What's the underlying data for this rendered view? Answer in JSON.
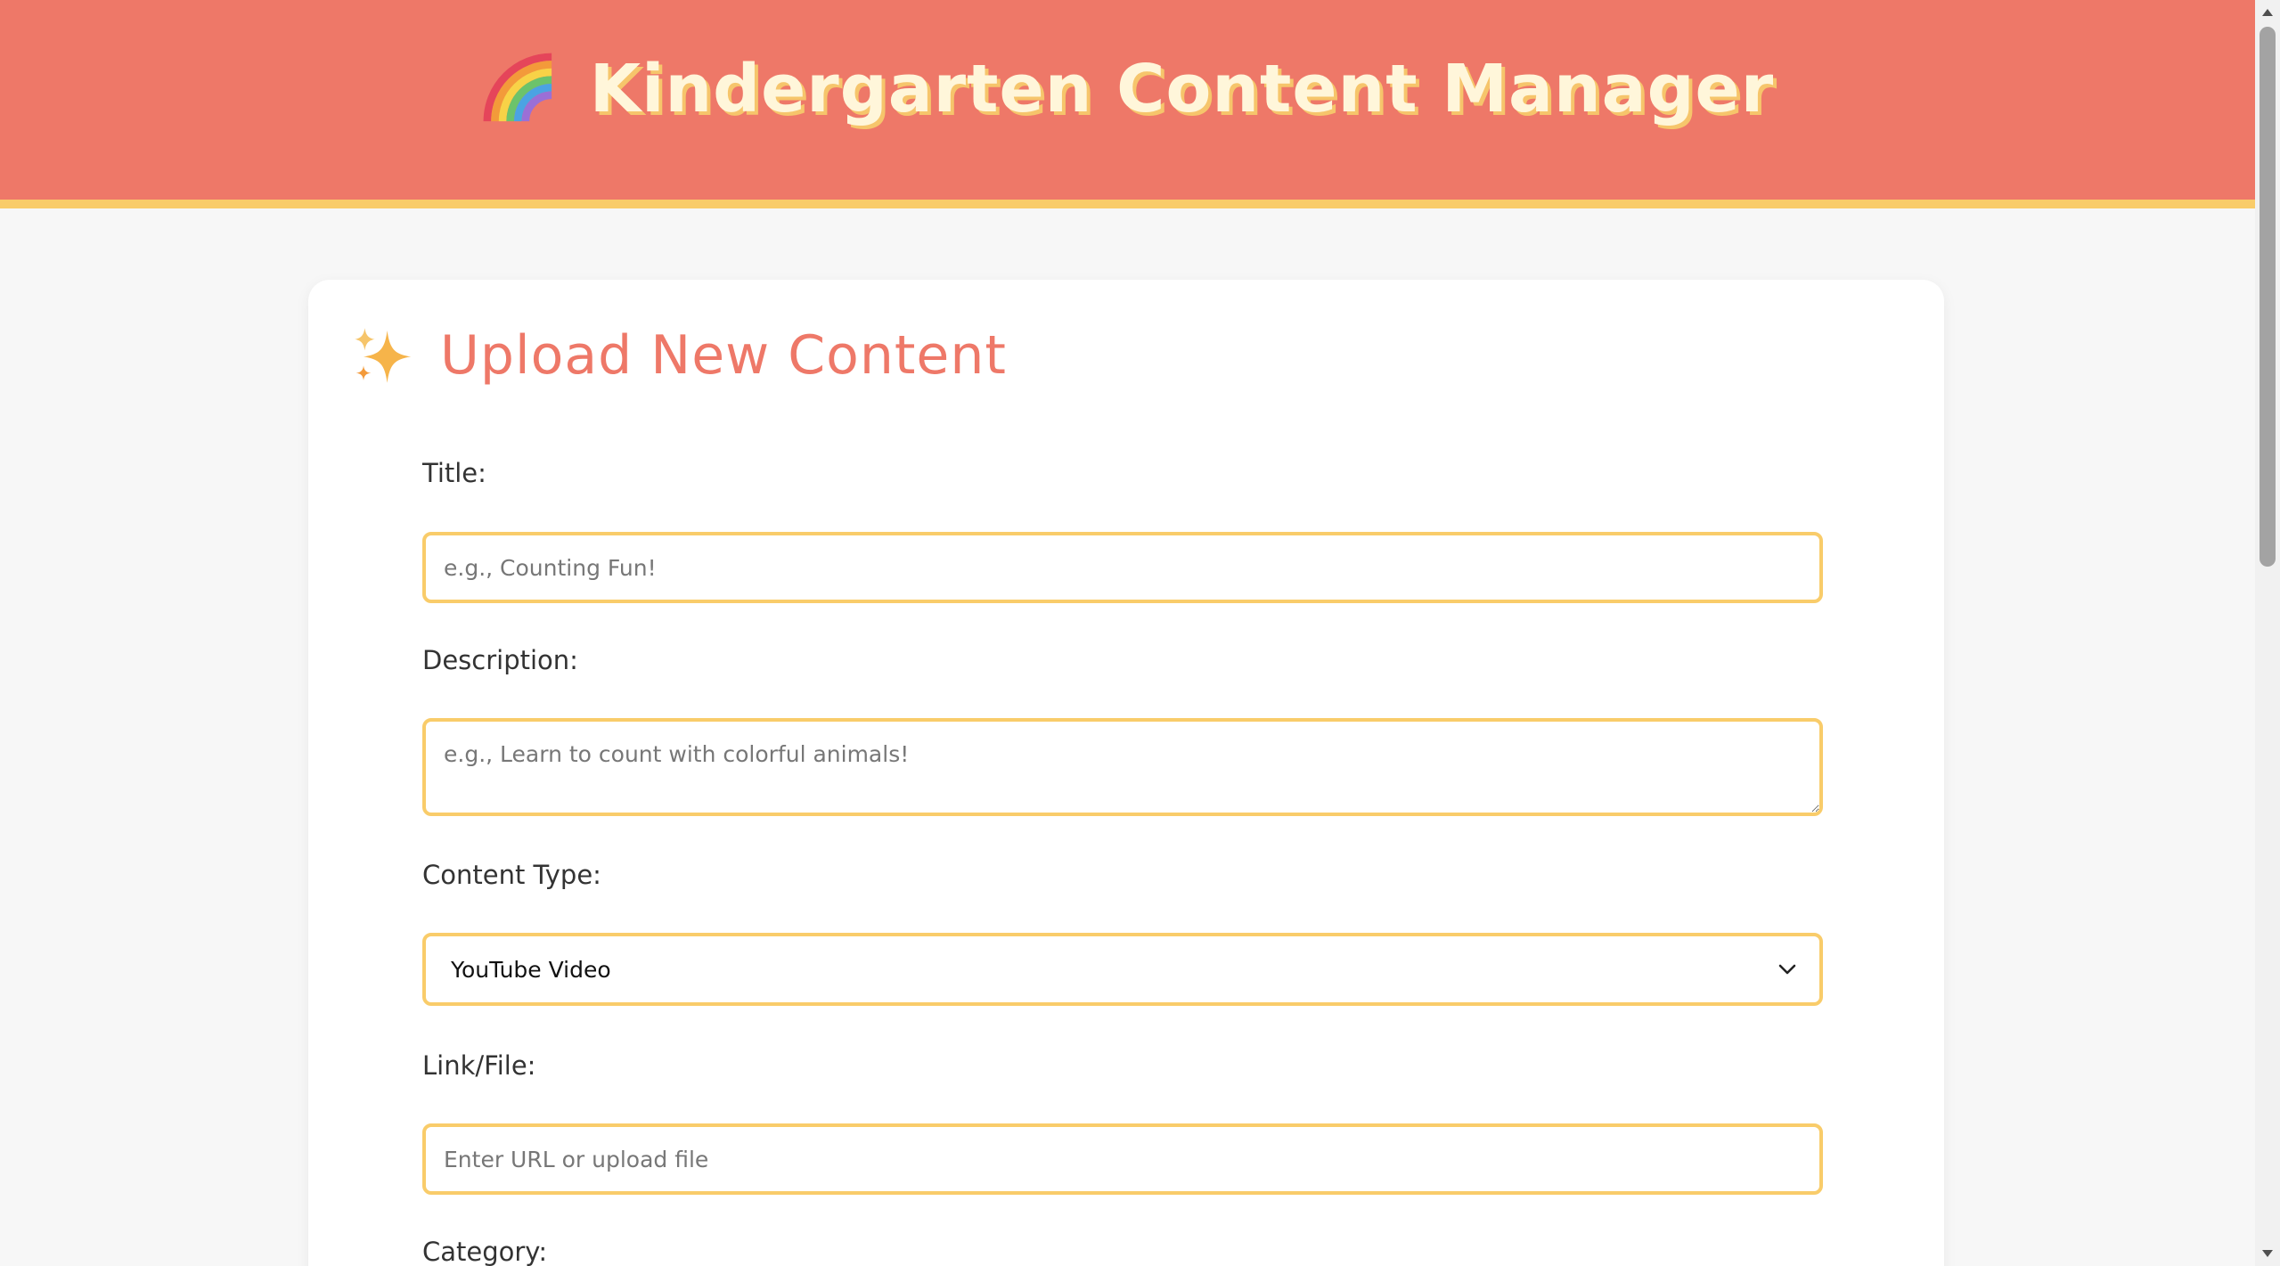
{
  "header": {
    "icon": "rainbow-icon",
    "title": "Kindergarten Content Manager"
  },
  "upload": {
    "icon": "sparkle-icon",
    "title": "Upload New Content",
    "fields": {
      "title": {
        "label": "Title:",
        "placeholder": "e.g., Counting Fun!",
        "value": ""
      },
      "description": {
        "label": "Description:",
        "placeholder": "e.g., Learn to count with colorful animals!",
        "value": ""
      },
      "content_type": {
        "label": "Content Type:",
        "selected": "YouTube Video"
      },
      "link": {
        "label": "Link/File:",
        "placeholder": "Enter URL or upload file",
        "value": ""
      },
      "category": {
        "label": "Category:"
      }
    }
  },
  "colors": {
    "header_bg": "#ee7868",
    "accent_yellow": "#f9cc6a",
    "heading_coral": "#ee7868",
    "page_bg": "#f7f7f7"
  }
}
